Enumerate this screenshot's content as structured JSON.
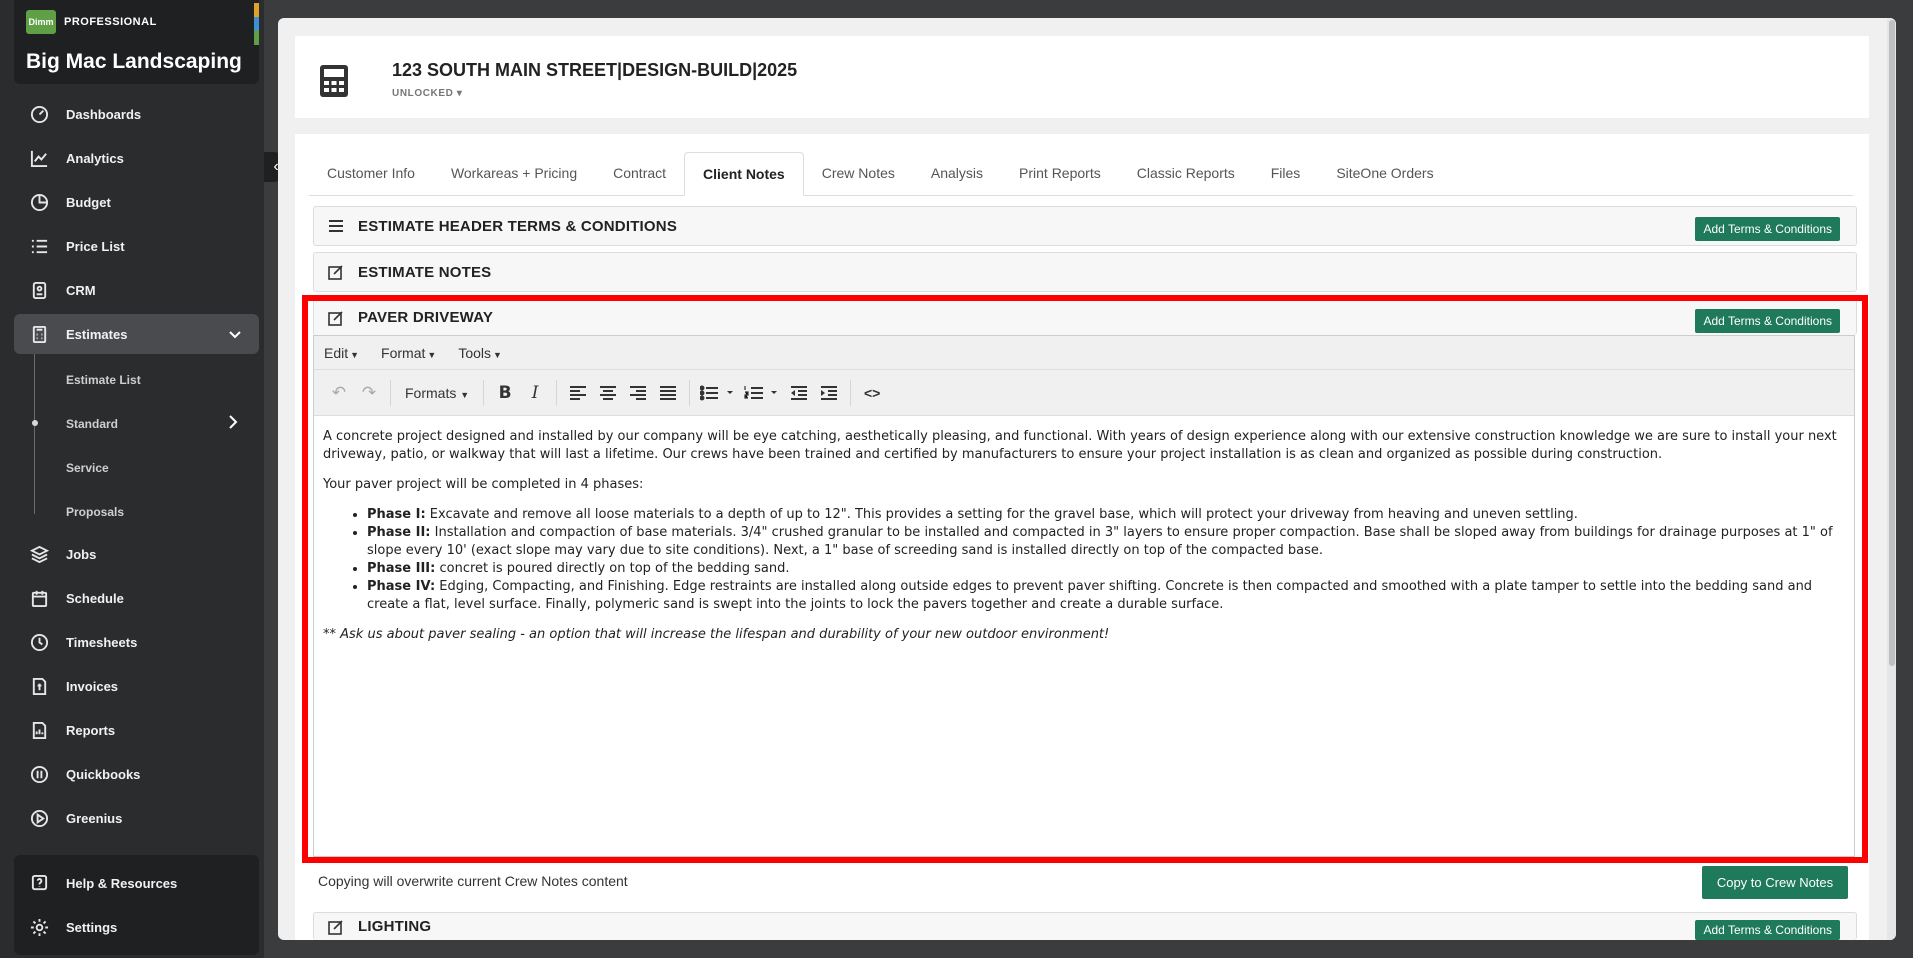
{
  "sidebar": {
    "logo_text": "Dimm",
    "tier": "PROFESSIONAL",
    "company": "Big Mac Landscaping",
    "items": [
      {
        "label": "Dashboards",
        "icon": "gauge-icon"
      },
      {
        "label": "Analytics",
        "icon": "line-chart-icon"
      },
      {
        "label": "Budget",
        "icon": "pie-chart-icon"
      },
      {
        "label": "Price List",
        "icon": "list-icon"
      },
      {
        "label": "CRM",
        "icon": "contact-card-icon"
      },
      {
        "label": "Estimates",
        "icon": "calculator-icon"
      },
      {
        "label": "Jobs",
        "icon": "stack-icon"
      },
      {
        "label": "Schedule",
        "icon": "calendar-icon"
      },
      {
        "label": "Timesheets",
        "icon": "clock-icon"
      },
      {
        "label": "Invoices",
        "icon": "invoice-icon"
      },
      {
        "label": "Reports",
        "icon": "report-icon"
      },
      {
        "label": "Quickbooks",
        "icon": "quickbooks-icon"
      },
      {
        "label": "Greenius",
        "icon": "play-circle-icon"
      }
    ],
    "sub_items": [
      "Estimate List",
      "Standard",
      "Service",
      "Proposals"
    ],
    "bottom_items": [
      {
        "label": "Help & Resources",
        "icon": "help-icon"
      },
      {
        "label": "Settings",
        "icon": "gear-icon"
      }
    ]
  },
  "header": {
    "title": "123 SOUTH MAIN STREET|DESIGN-BUILD|2025",
    "status": "UNLOCKED"
  },
  "tabs": [
    "Customer Info",
    "Workareas + Pricing",
    "Contract",
    "Client Notes",
    "Crew Notes",
    "Analysis",
    "Print Reports",
    "Classic Reports",
    "Files",
    "SiteOne Orders"
  ],
  "active_tab": "Client Notes",
  "sections": {
    "header_terms": {
      "title": "ESTIMATE HEADER TERMS & CONDITIONS",
      "button": "Add Terms & Conditions"
    },
    "notes": {
      "title": "ESTIMATE NOTES"
    },
    "paver": {
      "title": "PAVER DRIVEWAY",
      "button": "Add Terms & Conditions"
    },
    "lighting": {
      "title": "LIGHTING",
      "button": "Add Terms & Conditions"
    }
  },
  "editor": {
    "menus": [
      "Edit",
      "Format",
      "Tools"
    ],
    "formats_label": "Formats",
    "intro": "A concrete project designed and installed by our company will be eye catching, aesthetically pleasing, and functional. With years of design experience along with our extensive construction knowledge we are sure to install your next driveway, patio, or walkway that will last a lifetime.  Our crews have been trained and certified by manufacturers to ensure your project installation is as clean and organized as possible during construction.",
    "phases_intro": "Your paver project will be completed in 4 phases:",
    "phases": [
      {
        "label": "Phase I:",
        "text": "  Excavate and remove all loose materials to a depth of up to 12\".  This provides a setting for the gravel base, which will protect your driveway from heaving and uneven settling."
      },
      {
        "label": "Phase II:",
        "text": "  Installation and compaction of base materials.  3/4\" crushed granular to be installed and compacted in 3\" layers to ensure proper compaction.  Base shall be sloped away from buildings for drainage purposes at 1\" of slope every 10' (exact slope may vary due to site conditions).  Next, a 1\" base of screeding sand is installed directly on top of the compacted base."
      },
      {
        "label": "Phase III:",
        "text": " concret is poured directly on top of the bedding sand."
      },
      {
        "label": "Phase IV:",
        "text": " Edging, Compacting, and Finishing.  Edge restraints are installed along outside edges to prevent paver shifting.  Concrete is then compacted and smoothed with a plate tamper to settle into the bedding sand and create a flat, level surface.  Finally, polymeric sand is swept into the joints to lock the pavers together and create a durable surface."
      }
    ],
    "footer_prefix": "** ",
    "footer_note": "Ask us about paver sealing - an option that will increase the lifespan and durability of your new outdoor environment!"
  },
  "copy": {
    "note": "Copying will overwrite current Crew Notes content",
    "button": "Copy to Crew Notes"
  },
  "colors": {
    "accent_green": "#1f7a5b",
    "highlight_red": "#ff0000",
    "sidebar_bg": "#2b2c2e"
  }
}
